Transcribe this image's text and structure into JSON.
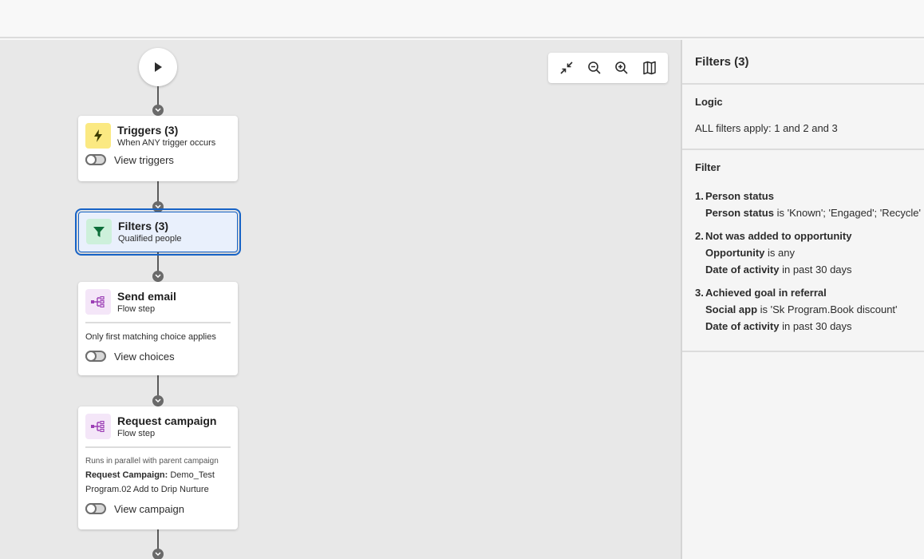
{
  "canvas": {
    "zoom_controls": [
      {
        "name": "collapse-icon"
      },
      {
        "name": "zoom-out-icon"
      },
      {
        "name": "zoom-in-icon"
      },
      {
        "name": "minimap-icon"
      }
    ],
    "nodes": {
      "triggers": {
        "title": "Triggers (3)",
        "subtitle": "When ANY trigger occurs",
        "toggle_label": "View triggers"
      },
      "filters": {
        "title": "Filters (3)",
        "subtitle": "Qualified people"
      },
      "send_email": {
        "title": "Send email",
        "subtitle": "Flow step",
        "description": "Only first matching choice applies",
        "toggle_label": "View choices"
      },
      "request_campaign": {
        "title": "Request campaign",
        "subtitle": "Flow step",
        "note": "Runs in parallel with parent campaign",
        "detail_label": "Request Campaign:",
        "detail_value": " Demo_Test",
        "detail_line2": "Program.02 Add to Drip Nurture",
        "toggle_label": "View campaign"
      }
    }
  },
  "panel": {
    "title": "Filters (3)",
    "logic": {
      "heading": "Logic",
      "text": "ALL filters apply: 1 and 2 and 3"
    },
    "filter": {
      "heading": "Filter",
      "items": [
        {
          "num": "1.",
          "title": "Person status",
          "conditions": [
            {
              "field": "Person status",
              "rest": " is 'Known'; 'Engaged'; 'Recycle'"
            }
          ]
        },
        {
          "num": "2.",
          "title": "Not was added to opportunity",
          "conditions": [
            {
              "field": "Opportunity",
              "rest": " is any"
            },
            {
              "field": "Date of activity",
              "rest": " in past 30 days"
            }
          ]
        },
        {
          "num": "3.",
          "title": "Achieved goal in referral",
          "conditions": [
            {
              "field": "Social app",
              "rest": " is 'Sk Program.Book discount'"
            },
            {
              "field": "Date of activity",
              "rest": " in past 30 days"
            }
          ]
        }
      ]
    }
  }
}
